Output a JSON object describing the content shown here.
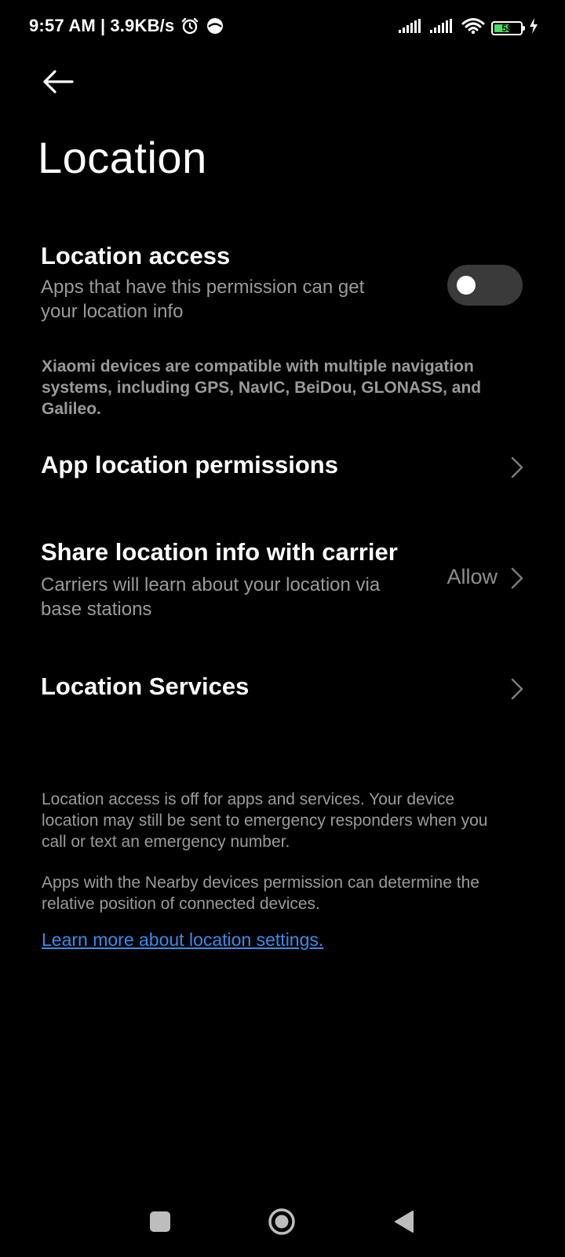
{
  "status_bar": {
    "time": "9:57 AM",
    "separator": "|",
    "net_speed": "3.9KB/s",
    "battery_level": "58",
    "battery_fraction": 0.58,
    "icons": [
      "alarm-icon",
      "vpn-icon",
      "signal-1-icon",
      "signal-2-icon",
      "wifi-icon",
      "battery-icon",
      "charging-icon"
    ]
  },
  "header": {
    "back_icon": "back-arrow-icon",
    "title": "Location"
  },
  "location_access": {
    "title": "Location access",
    "subtitle_line1": "Apps that have this permission can get",
    "subtitle_line2": "your location info",
    "toggle_state": "off"
  },
  "compat_note": {
    "line1": "Xiaomi devices are compatible with multiple navigation",
    "line2": "systems, including GPS, NavIC, BeiDou, GLONASS, and",
    "line3": "Galileo."
  },
  "rows": {
    "app_permissions": {
      "title": "App location permissions"
    },
    "share_carrier": {
      "title": "Share location info with carrier",
      "subtitle_line1": "Carriers will learn about your location via",
      "subtitle_line2": "base stations",
      "value": "Allow"
    },
    "location_services": {
      "title": "Location Services"
    }
  },
  "footer": {
    "para1_line1": "Location access is off for apps and services. Your device",
    "para1_line2": "location may still be sent to emergency responders when you",
    "para1_line3": "call or text an emergency number.",
    "para2_line1": "Apps with the Nearby devices permission can determine the",
    "para2_line2": "relative position of connected devices.",
    "link": "Learn more about location settings."
  },
  "nav_bar": {
    "buttons": [
      "recents-icon",
      "home-icon",
      "back-icon"
    ]
  },
  "colors": {
    "background": "#000000",
    "primary_text": "#ffffff",
    "secondary_text": "#9a9a9a",
    "link": "#3b8beb",
    "toggle_track": "#3a3a3a",
    "battery_fill": "#4cd964"
  }
}
